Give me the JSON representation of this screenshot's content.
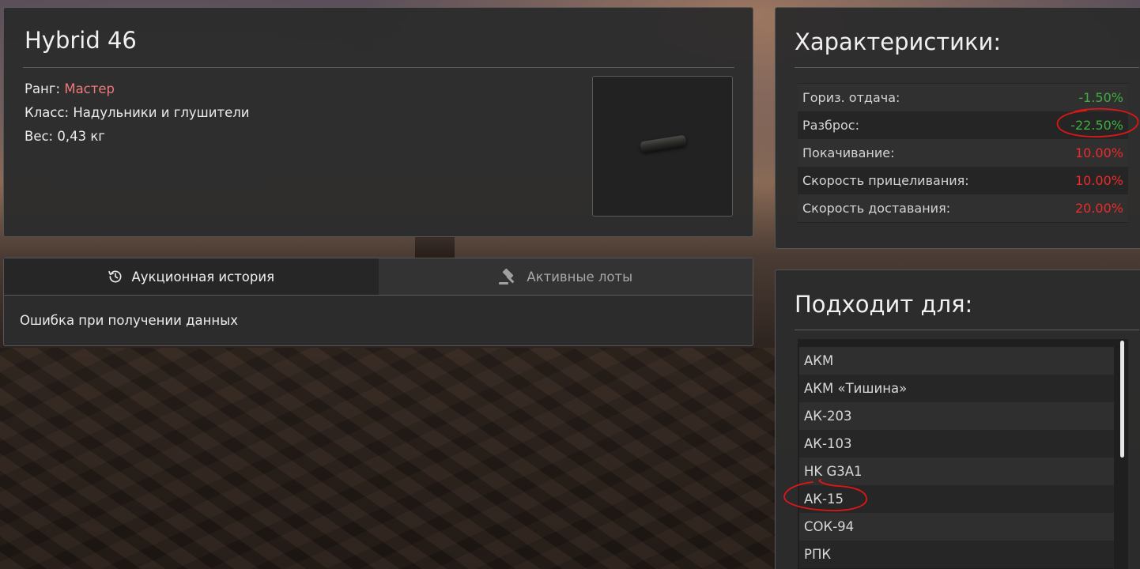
{
  "item": {
    "title": "Hybrid 46",
    "rank_label": "Ранг:",
    "rank_value": "Мастер",
    "class_text": "Класс: Надульники и глушители",
    "weight_text": "Вес: 0,43 кг",
    "image_icon": "silencer-image"
  },
  "tabs": {
    "history_label": "Аукционная история",
    "active_label": "Активные лоты",
    "history_icon": "history-icon",
    "active_icon": "gavel-icon",
    "content_text": "Ошибка при получении данных"
  },
  "stats": {
    "title": "Характеристики:",
    "rows": [
      {
        "label": "Гориз. отдача:",
        "value": "-1.50%",
        "kind": "good"
      },
      {
        "label": "Разброс:",
        "value": "-22.50%",
        "kind": "good"
      },
      {
        "label": "Покачивание:",
        "value": "10.00%",
        "kind": "bad"
      },
      {
        "label": "Скорость прицеливания:",
        "value": "10.00%",
        "kind": "bad"
      },
      {
        "label": "Скорость доставания:",
        "value": "20.00%",
        "kind": "bad"
      }
    ]
  },
  "fits": {
    "title": "Подходит для:",
    "items": [
      "АКМ",
      "АКМ «Тишина»",
      "АК-203",
      "АК-103",
      "HK G3A1",
      "АК-15",
      "СОК-94",
      "РПК"
    ]
  },
  "colors": {
    "good": "#3fae3f",
    "bad": "#ee2a2a",
    "rank": "#f07878",
    "annotation": "#e01616"
  }
}
